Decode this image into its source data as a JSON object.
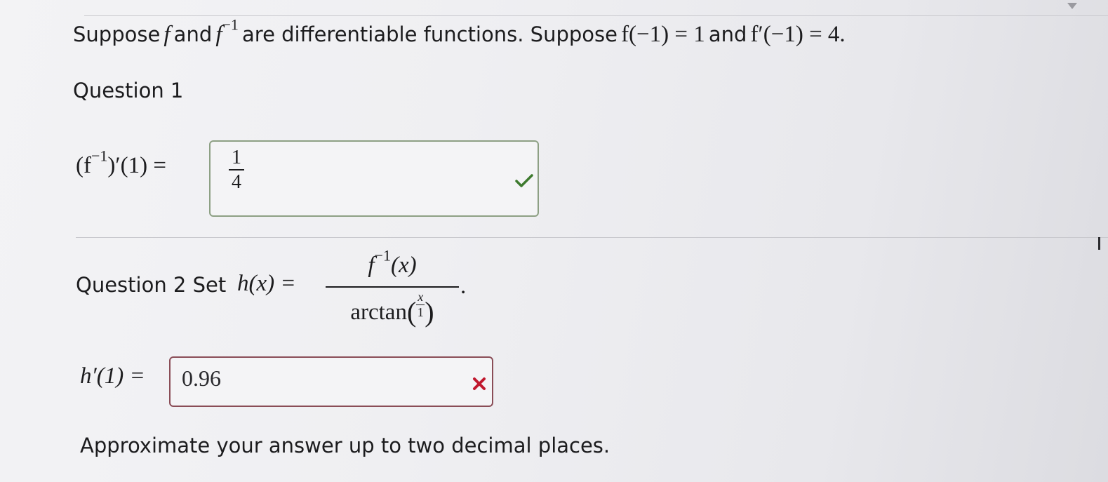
{
  "intro": {
    "t1": "Suppose",
    "f": "f",
    "t2": "and",
    "finv_base": "f",
    "finv_exp": "−1",
    "t3": "are differentiable functions. Suppose",
    "eq1": "f(−1) = 1",
    "t4": "and",
    "eq2": "f′(−1) = 4."
  },
  "q1": {
    "title": "Question 1",
    "lhs_open": "(f",
    "lhs_exp": "−1",
    "lhs_close": ")′(1) =",
    "answer_num": "1",
    "answer_den": "4",
    "status_icon": "check-icon"
  },
  "q2": {
    "prefix": "Question 2 Set",
    "h": "h(x) =",
    "num_base": "f",
    "num_exp": "−1",
    "num_arg": "(x)",
    "den_fn": "arctan",
    "den_inner_num": "x",
    "den_inner_den": "1",
    "period": ".",
    "lhs": "h′(1) =",
    "answer": "0.96",
    "status_icon": "x-icon"
  },
  "instructions": "Approximate your answer up to two decimal places.",
  "colors": {
    "correct": "#3d7a2e",
    "wrong": "#c0182e"
  }
}
